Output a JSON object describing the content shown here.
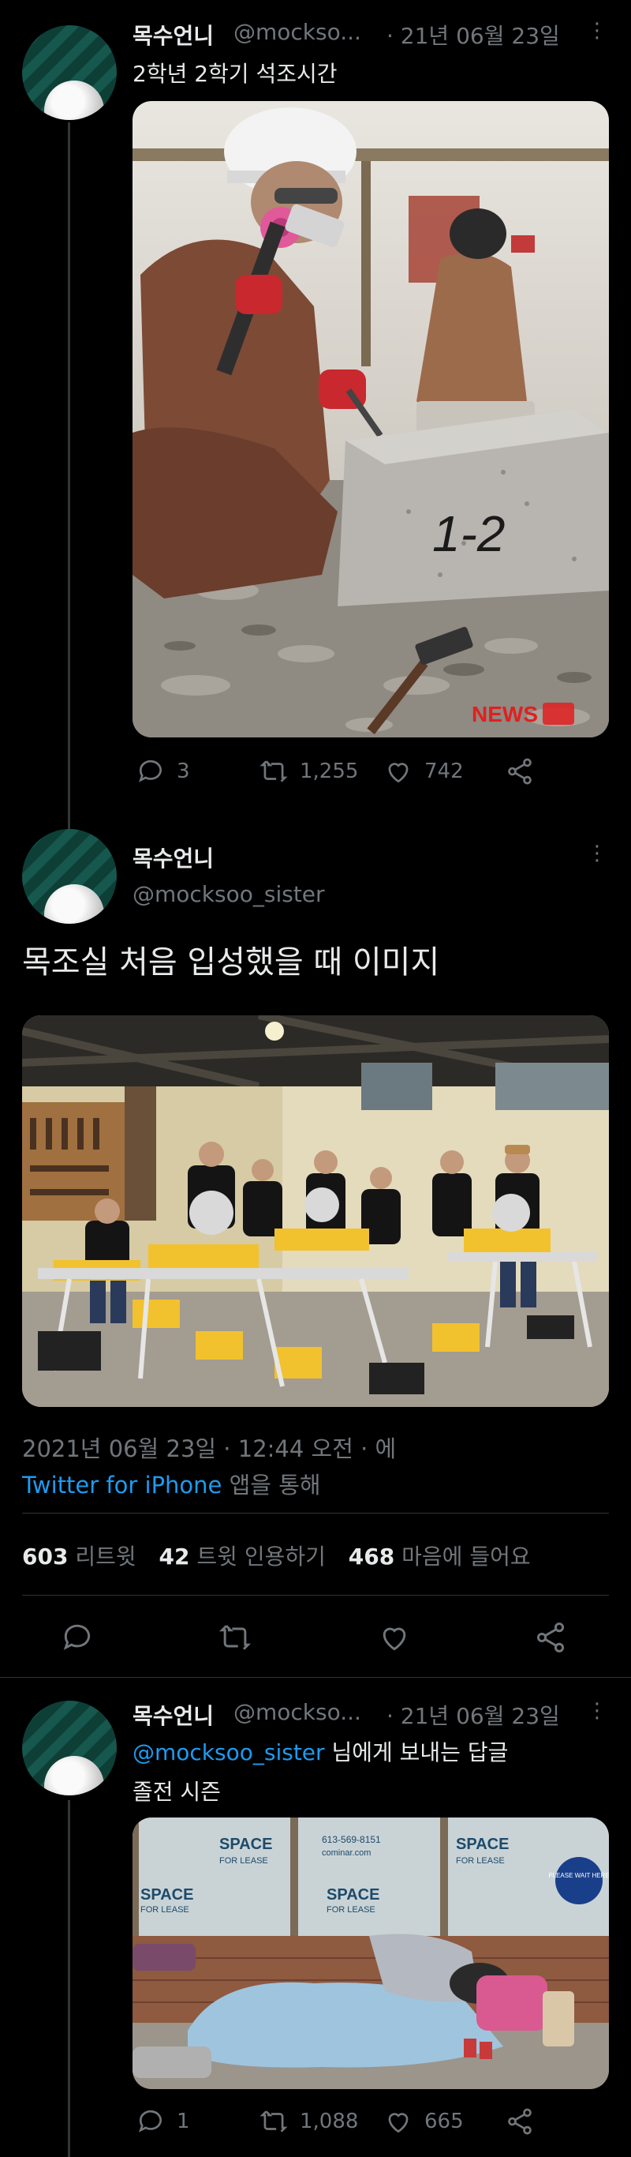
{
  "tweet1": {
    "name": "목수언니",
    "handle": "@mockso...",
    "time": "· 21년 06월 23일",
    "text": "2학년 2학기 석조시간",
    "photo_stamp": "1-2",
    "photo_watermark": "NEWS",
    "replies": "3",
    "retweets": "1,255",
    "likes": "742"
  },
  "tweet2": {
    "name": "목수언니",
    "handle": "@mocksoo_sister",
    "text": "목조실 처음 입성했을 때 이미지",
    "timestamp": "2021년 06월 23일 · 12:44 오전 · 에",
    "via_link": "Twitter for iPhone",
    "via_suffix": "앱을 통해",
    "stats": {
      "retweets_count": "603",
      "retweets_label": "리트윗",
      "quotes_count": "42",
      "quotes_label": "트윗 인용하기",
      "likes_count": "468",
      "likes_label": "마음에 들어요"
    }
  },
  "tweet3": {
    "name": "목수언니",
    "handle": "@mockso...",
    "time": "· 21년 06월 23일",
    "reply_to_handle": "@mocksoo_sister",
    "reply_to_suffix": "님에게 보내는 답글",
    "text": "졸전 시즌",
    "photo_signs": [
      "SPACE",
      "FOR LEASE",
      "613-569-8151",
      "cominar.com"
    ],
    "photo_badge": "PLEASE WAIT HERE",
    "replies": "1",
    "retweets": "1,088",
    "likes": "665"
  },
  "more_glyph": "⋮"
}
